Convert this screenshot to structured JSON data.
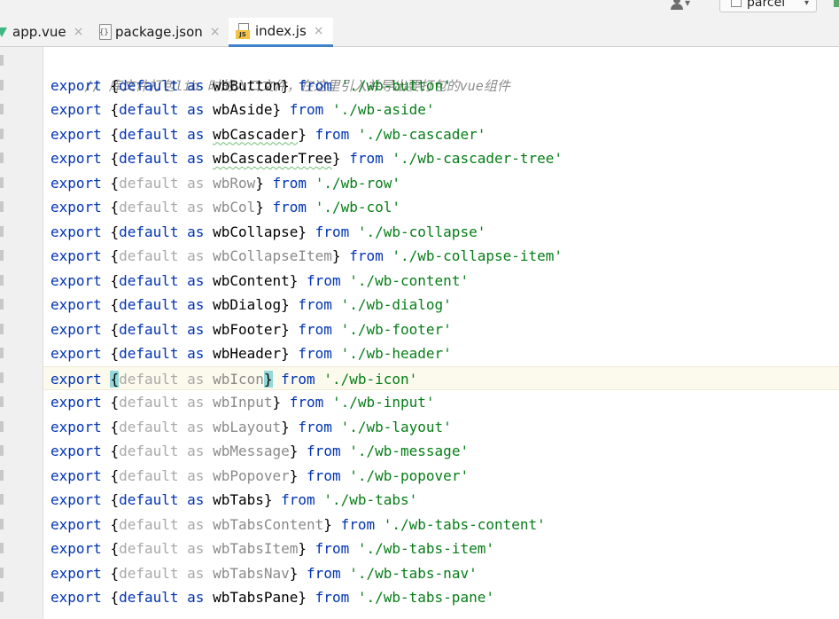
{
  "toolbar": {
    "user_caret": "▾",
    "run_config": "parcel",
    "run_caret": "▾"
  },
  "tabs": [
    {
      "label": "app.vue",
      "close": "×",
      "icon": "vue-icon"
    },
    {
      "label": "package.json",
      "close": "×",
      "icon": "json-file-icon"
    },
    {
      "label": "index.js",
      "close": "×",
      "icon": "js-file-icon",
      "active": true
    }
  ],
  "editor": {
    "comment": "// 库文件打包lib 时的入口文件，在这里引入并导出要打包的vue组件",
    "lines": [
      {
        "kw1": "export",
        "open": "{",
        "kw2": "default",
        "kw3": "as",
        "name": "wbButton",
        "close": "}",
        "kw4": "from",
        "path": "'./wb-button'",
        "dim": false,
        "wavy": false
      },
      {
        "kw1": "export",
        "open": "{",
        "kw2": "default",
        "kw3": "as",
        "name": "wbAside",
        "close": "}",
        "kw4": "from",
        "path": "'./wb-aside'",
        "dim": false,
        "wavy": false
      },
      {
        "kw1": "export",
        "open": "{",
        "kw2": "default",
        "kw3": "as",
        "name": "wbCascader",
        "close": "}",
        "kw4": "from",
        "path": "'./wb-cascader'",
        "dim": false,
        "wavy": true
      },
      {
        "kw1": "export",
        "open": "{",
        "kw2": "default",
        "kw3": "as",
        "name": "wbCascaderTree",
        "close": "}",
        "kw4": "from",
        "path": "'./wb-cascader-tree'",
        "dim": false,
        "wavy": true
      },
      {
        "kw1": "export",
        "open": "{",
        "kw2": "default",
        "kw3": "as",
        "name": "wbRow",
        "close": "}",
        "kw4": "from",
        "path": "'./wb-row'",
        "dim": true,
        "wavy": false
      },
      {
        "kw1": "export",
        "open": "{",
        "kw2": "default",
        "kw3": "as",
        "name": "wbCol",
        "close": "}",
        "kw4": "from",
        "path": "'./wb-col'",
        "dim": true,
        "wavy": false
      },
      {
        "kw1": "export",
        "open": "{",
        "kw2": "default",
        "kw3": "as",
        "name": "wbCollapse",
        "close": "}",
        "kw4": "from",
        "path": "'./wb-collapse'",
        "dim": false,
        "wavy": false
      },
      {
        "kw1": "export",
        "open": "{",
        "kw2": "default",
        "kw3": "as",
        "name": "wbCollapseItem",
        "close": "}",
        "kw4": "from",
        "path": "'./wb-collapse-item'",
        "dim": true,
        "wavy": false
      },
      {
        "kw1": "export",
        "open": "{",
        "kw2": "default",
        "kw3": "as",
        "name": "wbContent",
        "close": "}",
        "kw4": "from",
        "path": "'./wb-content'",
        "dim": false,
        "wavy": false
      },
      {
        "kw1": "export",
        "open": "{",
        "kw2": "default",
        "kw3": "as",
        "name": "wbDialog",
        "close": "}",
        "kw4": "from",
        "path": "'./wb-dialog'",
        "dim": false,
        "wavy": false
      },
      {
        "kw1": "export",
        "open": "{",
        "kw2": "default",
        "kw3": "as",
        "name": "wbFooter",
        "close": "}",
        "kw4": "from",
        "path": "'./wb-footer'",
        "dim": false,
        "wavy": false
      },
      {
        "kw1": "export",
        "open": "{",
        "kw2": "default",
        "kw3": "as",
        "name": "wbHeader",
        "close": "}",
        "kw4": "from",
        "path": "'./wb-header'",
        "dim": false,
        "wavy": false
      },
      {
        "kw1": "export",
        "open": "{",
        "kw2": "default",
        "kw3": "as",
        "name": "wbIcon",
        "close": "}",
        "kw4": "from",
        "path": "'./wb-icon'",
        "dim": true,
        "wavy": false,
        "current": true
      },
      {
        "kw1": "export",
        "open": "{",
        "kw2": "default",
        "kw3": "as",
        "name": "wbInput",
        "close": "}",
        "kw4": "from",
        "path": "'./wb-input'",
        "dim": true,
        "wavy": false
      },
      {
        "kw1": "export",
        "open": "{",
        "kw2": "default",
        "kw3": "as",
        "name": "wbLayout",
        "close": "}",
        "kw4": "from",
        "path": "'./wb-layout'",
        "dim": true,
        "wavy": false
      },
      {
        "kw1": "export",
        "open": "{",
        "kw2": "default",
        "kw3": "as",
        "name": "wbMessage",
        "close": "}",
        "kw4": "from",
        "path": "'./wb-message'",
        "dim": true,
        "wavy": false
      },
      {
        "kw1": "export",
        "open": "{",
        "kw2": "default",
        "kw3": "as",
        "name": "wbPopover",
        "close": "}",
        "kw4": "from",
        "path": "'./wb-popover'",
        "dim": true,
        "wavy": false
      },
      {
        "kw1": "export",
        "open": "{",
        "kw2": "default",
        "kw3": "as",
        "name": "wbTabs",
        "close": "}",
        "kw4": "from",
        "path": "'./wb-tabs'",
        "dim": false,
        "wavy": false
      },
      {
        "kw1": "export",
        "open": "{",
        "kw2": "default",
        "kw3": "as",
        "name": "wbTabsContent",
        "close": "}",
        "kw4": "from",
        "path": "'./wb-tabs-content'",
        "dim": true,
        "wavy": false
      },
      {
        "kw1": "export",
        "open": "{",
        "kw2": "default",
        "kw3": "as",
        "name": "wbTabsItem",
        "close": "}",
        "kw4": "from",
        "path": "'./wb-tabs-item'",
        "dim": true,
        "wavy": false
      },
      {
        "kw1": "export",
        "open": "{",
        "kw2": "default",
        "kw3": "as",
        "name": "wbTabsNav",
        "close": "}",
        "kw4": "from",
        "path": "'./wb-tabs-nav'",
        "dim": true,
        "wavy": false
      },
      {
        "kw1": "export",
        "open": "{",
        "kw2": "default",
        "kw3": "as",
        "name": "wbTabsPane",
        "close": "}",
        "kw4": "from",
        "path": "'./wb-tabs-pane'",
        "dim": false,
        "wavy": false
      }
    ]
  },
  "colors": {
    "keyword": "#0033b3",
    "string": "#067d17",
    "comment": "#8c8c8c",
    "unused": "#a9a9a9",
    "tab_underline": "#4083c9",
    "brace_match": "#93d9d9"
  }
}
